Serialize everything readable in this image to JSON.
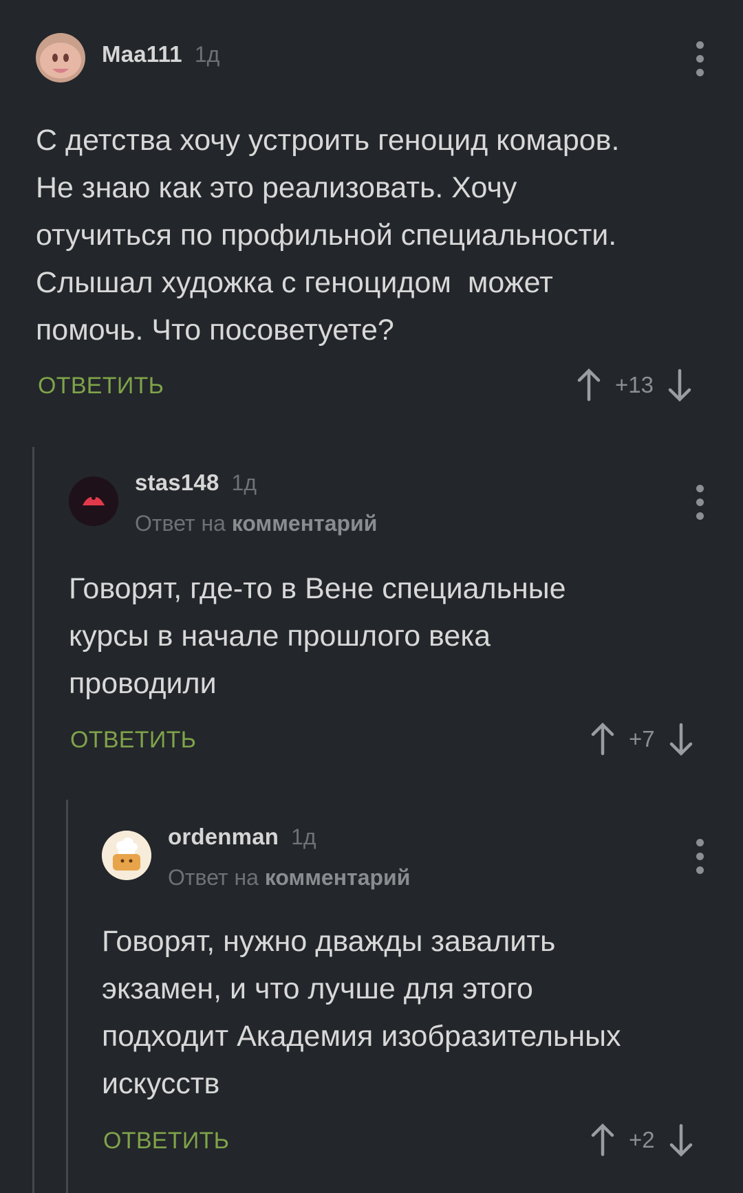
{
  "comments": [
    {
      "username": "Maa111",
      "age": "1д",
      "reply_to_prefix": "",
      "reply_to_link": "",
      "text": "С детства хочу устроить геноцид комаров.\nНе знаю как это реализовать. Хочу\nотучиться по профильной специальности.\nСлышал художка с геноцидом  может\nпомочь. Что посоветуете?",
      "reply_label": "ОТВЕТИТЬ",
      "score": "+13"
    },
    {
      "username": "stas148",
      "age": "1д",
      "reply_to_prefix": "Ответ на ",
      "reply_to_link": "комментарий",
      "text": "Говорят, где-то в Вене специальные\nкурсы в начале прошлого века\nпроводили",
      "reply_label": "ОТВЕТИТЬ",
      "score": "+7"
    },
    {
      "username": "ordenman",
      "age": "1д",
      "reply_to_prefix": "Ответ на ",
      "reply_to_link": "комментарий",
      "text": "Говорят, нужно дважды завалить\nэкзамен, и что лучше для этого\nподходит Академия изобразительных\nискусств",
      "reply_label": "ОТВЕТИТЬ",
      "score": "+2"
    }
  ],
  "icons": {
    "more": "kebab-menu-icon",
    "upvote": "arrow-up-icon",
    "downvote": "arrow-down-icon"
  },
  "colors": {
    "background": "#23262a",
    "reply_green": "#7fa34a",
    "muted": "#6e7276"
  }
}
